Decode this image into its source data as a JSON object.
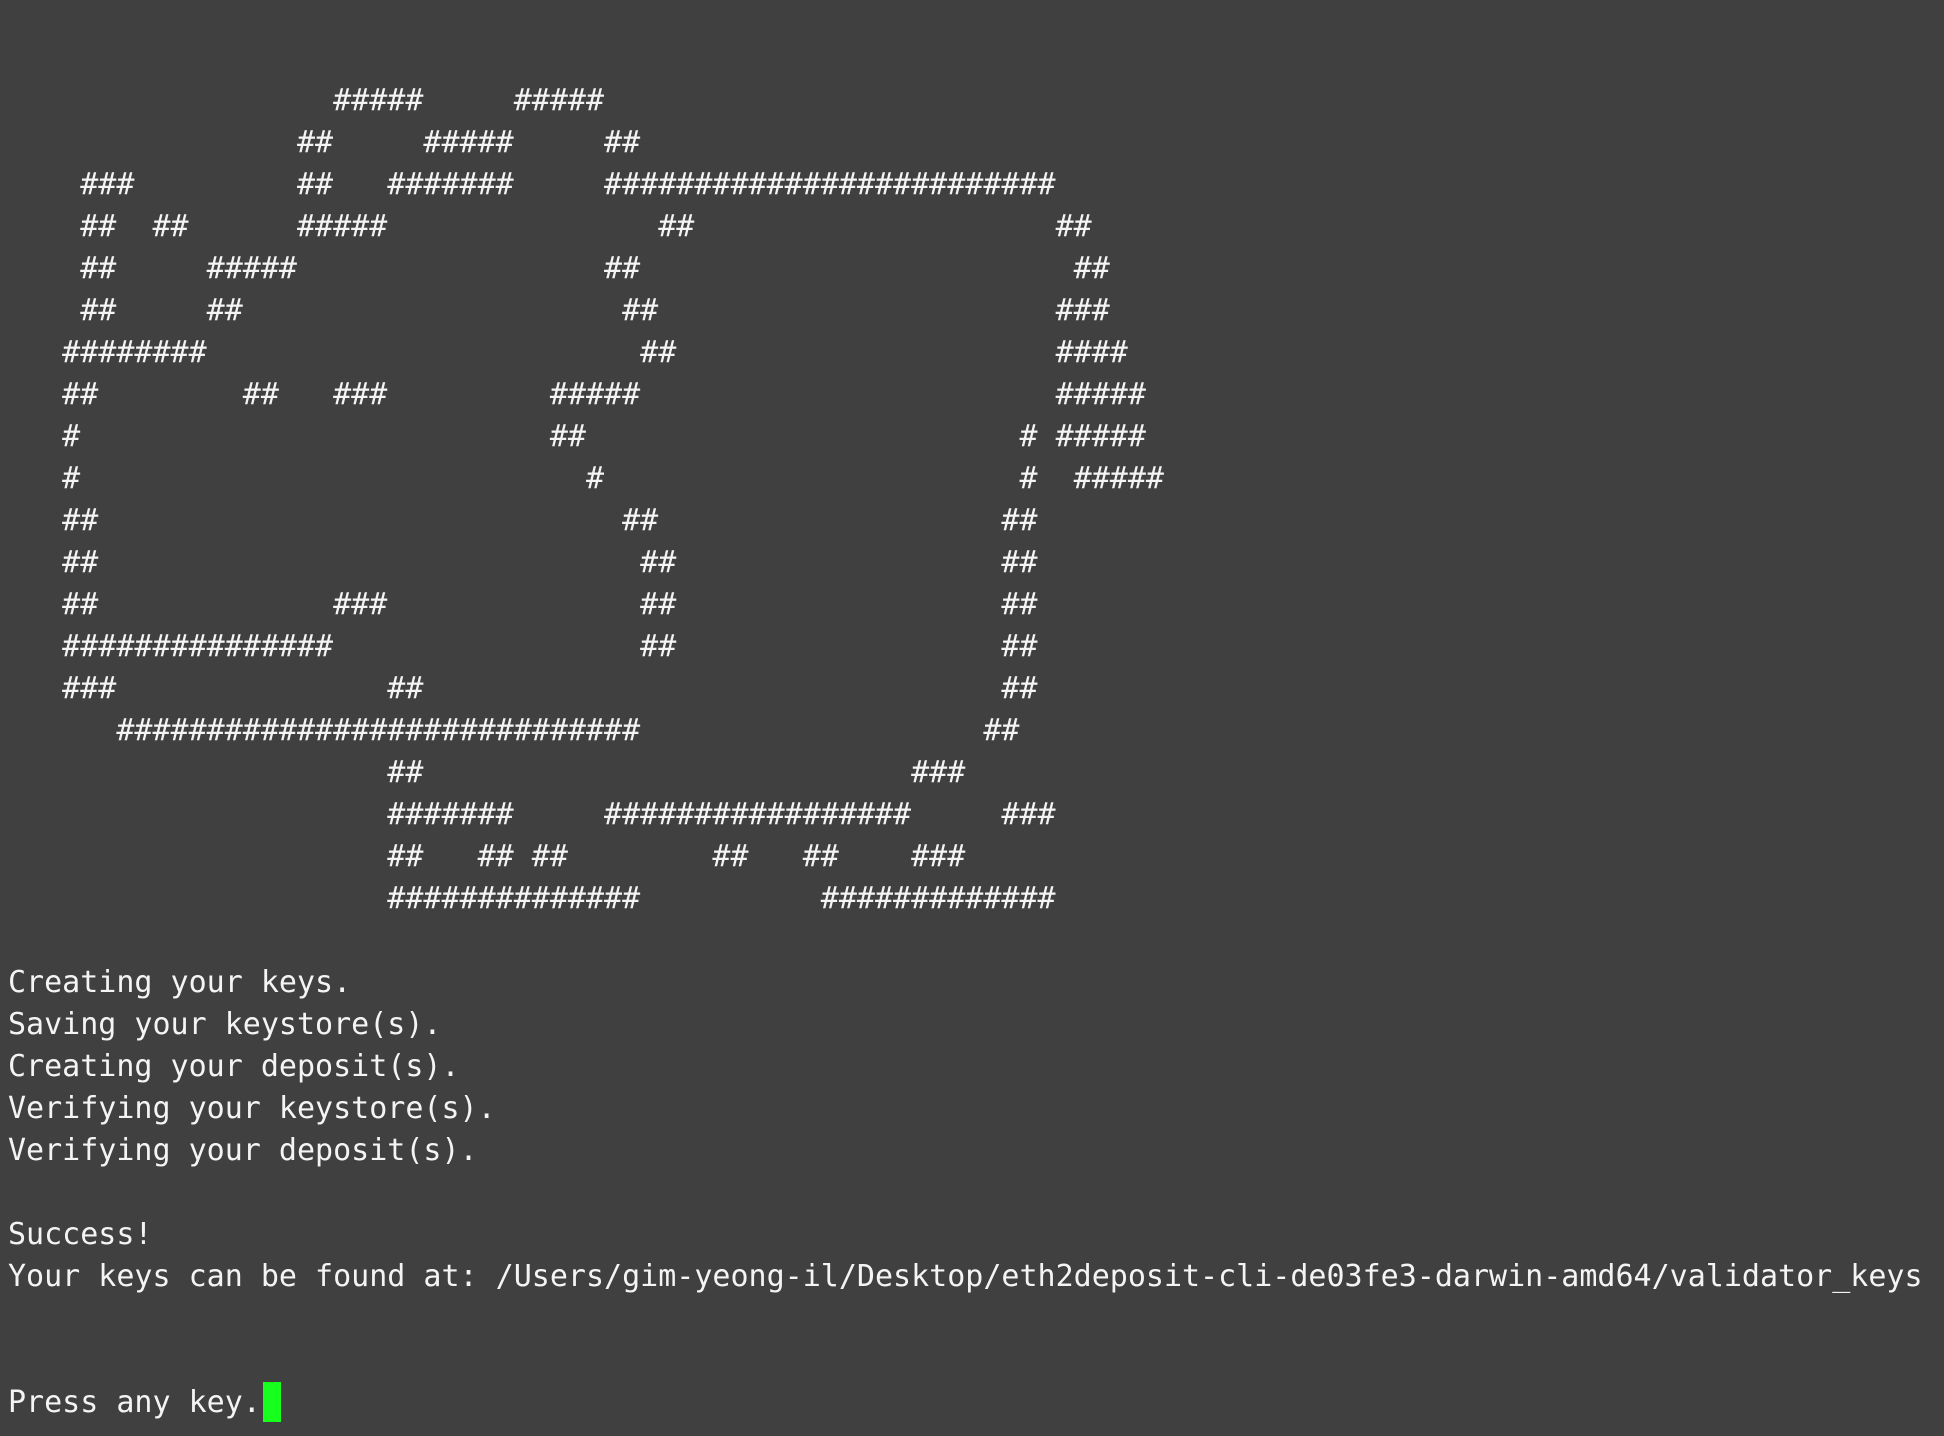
{
  "terminal": {
    "colors": {
      "background": "#404040",
      "text": "#f4f4f4",
      "cursor": "#17ff1c"
    },
    "art": [
      "                  #####     #####",
      "                ##     #####     ##",
      "    ###         ##   #######     #########################",
      "    ##  ##      #####               ##                    ##",
      "    ##     #####                 ##                        ##",
      "    ##     ##                     ##                      ###",
      "   ########                        ##                     ####",
      "   ##        ##   ###         #####                       #####",
      "   #                          ##                        # #####",
      "   #                            #                       #  #####",
      "   ##                             ##                   ##",
      "   ##                              ##                  ##",
      "   ##             ###              ##                  ##",
      "   ###############                 ##                  ##",
      "   ###               ##                                ##",
      "      #############################                   ##",
      "                     ##                           ###",
      "                     #######     #################     ###",
      "                     ##   ## ##        ##   ##    ###",
      "                     ##############          #############"
    ],
    "status_lines": [
      "Creating your keys.",
      "Saving your keystore(s).",
      "Creating your deposit(s).",
      "Verifying your keystore(s).",
      "Verifying your deposit(s)."
    ],
    "success": "Success!",
    "keys_path": "Your keys can be found at: /Users/gim-yeong-il/Desktop/eth2deposit-cli-de03fe3-darwin-amd64/validator_keys",
    "prompt": "Press any key."
  }
}
